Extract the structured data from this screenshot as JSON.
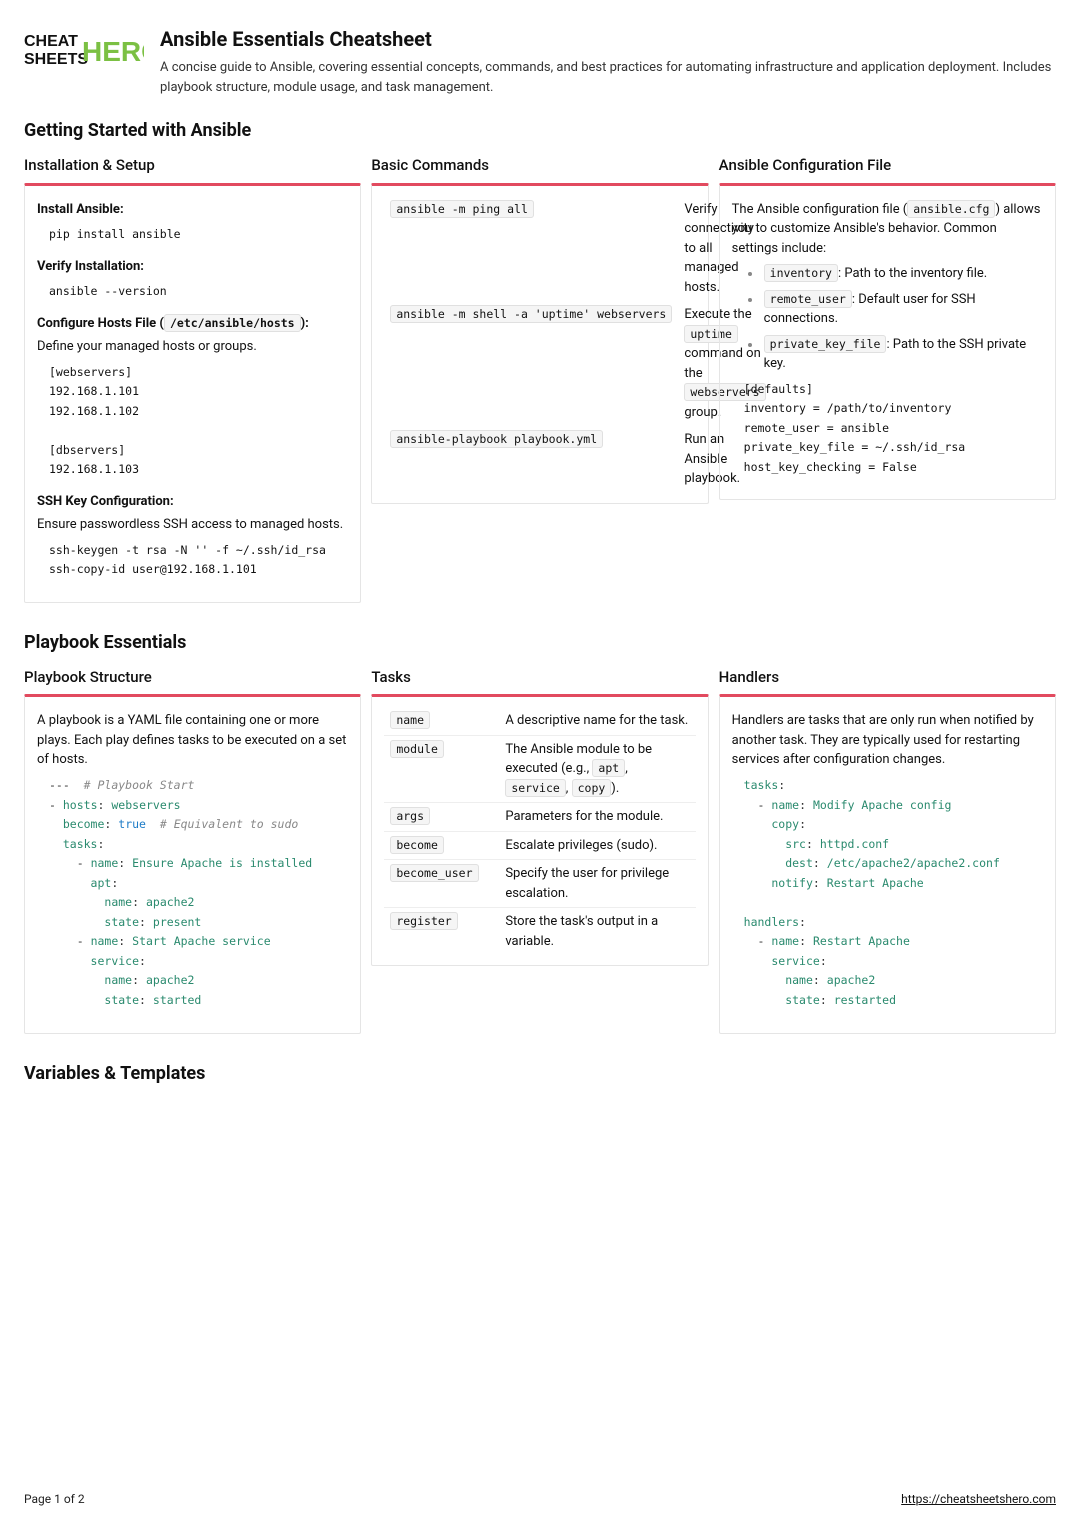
{
  "header": {
    "logo_text1": "CHEAT",
    "logo_text2": "SHEETS",
    "logo_text3": "HERO",
    "title": "Ansible Essentials Cheatsheet",
    "subtitle": "A concise guide to Ansible, covering essential concepts, commands, and best practices for automating infrastructure and application deployment. Includes playbook structure, module usage, and task management."
  },
  "section1": {
    "title": "Getting Started with Ansible",
    "col1": {
      "title": "Installation & Setup",
      "install_label": "Install Ansible:",
      "install_code": "pip install ansible",
      "verify_label": "Verify Installation:",
      "verify_code": "ansible --version",
      "hosts_label_pre": "Configure Hosts File (",
      "hosts_path": "/etc/ansible/hosts",
      "hosts_label_post": "):",
      "hosts_desc": "Define your managed hosts or groups.",
      "hosts_code": "[webservers]\n192.168.1.101\n192.168.1.102\n\n[dbservers]\n192.168.1.103",
      "ssh_label": "SSH Key Configuration:",
      "ssh_desc": "Ensure passwordless SSH access to managed hosts.",
      "ssh_code": "ssh-keygen -t rsa -N '' -f ~/.ssh/id_rsa\nssh-copy-id user@192.168.1.101"
    },
    "col2": {
      "title": "Basic Commands",
      "rows": [
        {
          "cmd": "ansible -m ping all",
          "desc_pre": "Verify connectivity to all managed hosts."
        },
        {
          "cmd": "ansible -m shell -a 'uptime' webservers",
          "desc_parts": [
            "Execute the ",
            "uptime",
            " command on the ",
            "webservers",
            " group."
          ]
        },
        {
          "cmd": "ansible-playbook playbook.yml",
          "desc_pre": "Run an Ansible playbook."
        }
      ]
    },
    "col3": {
      "title": "Ansible Configuration File",
      "intro_pre": "The Ansible configuration file (",
      "intro_code": "ansible.cfg",
      "intro_post": ") allows you to customize Ansible's behavior. Common settings include:",
      "items": [
        {
          "code": "inventory",
          "text": ": Path to the inventory file."
        },
        {
          "code": "remote_user",
          "text": ": Default user for SSH connections."
        },
        {
          "code": "private_key_file",
          "text": ": Path to the SSH private key."
        }
      ],
      "config_code": "[defaults]\ninventory = /path/to/inventory\nremote_user = ansible\nprivate_key_file = ~/.ssh/id_rsa\nhost_key_checking = False"
    }
  },
  "section2": {
    "title": "Playbook Essentials",
    "col1": {
      "title": "Playbook Structure",
      "desc": "A playbook is a YAML file containing one or more plays. Each play defines tasks to be executed on a set of hosts."
    },
    "col2": {
      "title": "Tasks",
      "rows": [
        {
          "k": "name",
          "v": "A descriptive name for the task."
        },
        {
          "k": "module",
          "v_parts": [
            "The Ansible module to be executed (e.g., ",
            "apt",
            ", ",
            "service",
            ", ",
            "copy",
            ")."
          ]
        },
        {
          "k": "args",
          "v": "Parameters for the module."
        },
        {
          "k": "become",
          "v": "Escalate privileges (sudo)."
        },
        {
          "k": "become_user",
          "v": "Specify the user for privilege escalation."
        },
        {
          "k": "register",
          "v": "Store the task's output in a variable."
        }
      ]
    },
    "col3": {
      "title": "Handlers",
      "desc": "Handlers are tasks that are only run when notified by another task. They are typically used for restarting services after configuration changes."
    }
  },
  "section3": {
    "title": "Variables & Templates"
  },
  "footer": {
    "page": "Page 1 of 2",
    "url": "https://cheatsheetshero.com"
  }
}
